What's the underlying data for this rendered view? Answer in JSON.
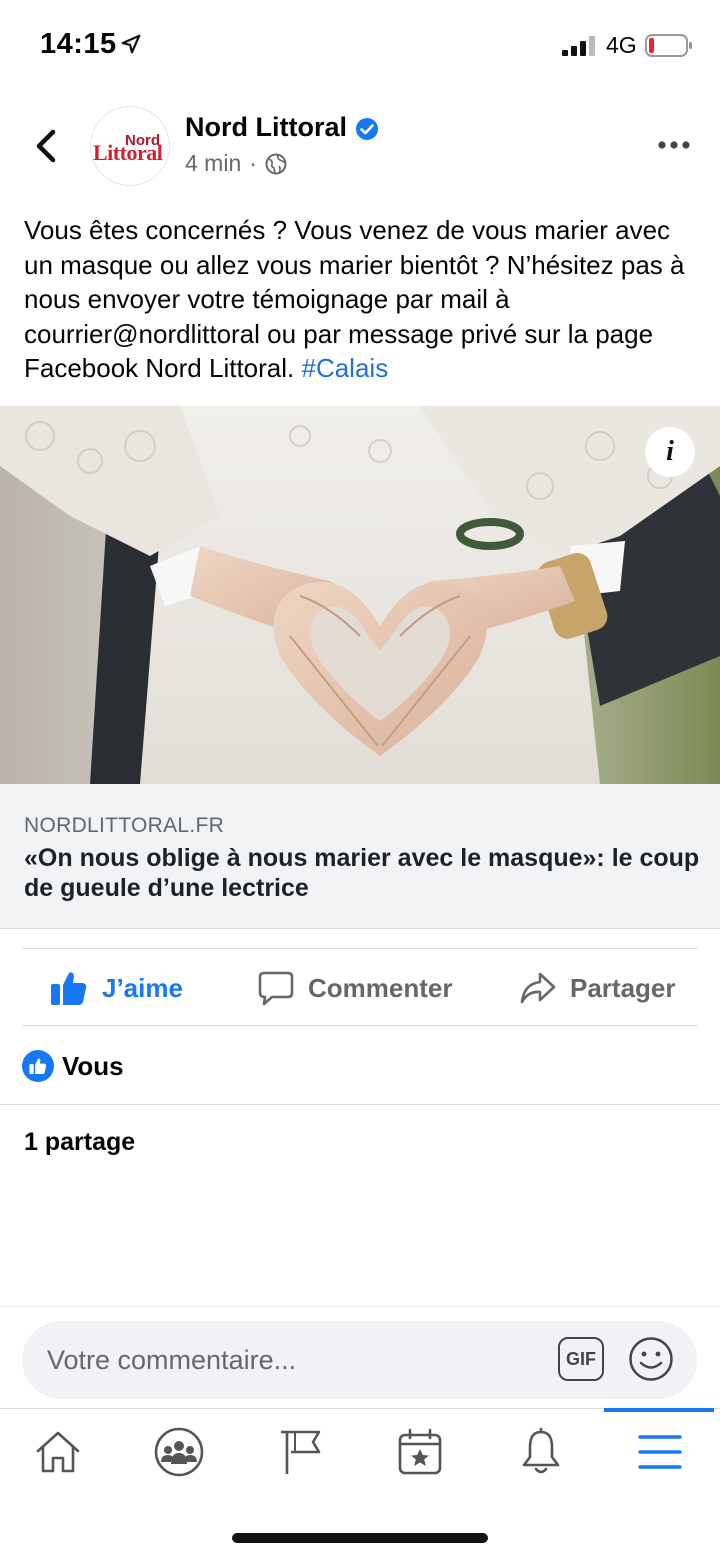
{
  "status_bar": {
    "time": "14:15",
    "network": "4G"
  },
  "post": {
    "page_name": "Nord Littoral",
    "avatar_logo": {
      "line1": "Nord",
      "line2": "Littoral"
    },
    "time_ago": "4 min",
    "separator": "·",
    "text": "Vous êtes concernés ? Vous venez de vous marier avec un masque ou allez vous marier bientôt ? N’hésitez pas à nous envoyer votre témoignage par mail à courrier@nordlittoral ou par message privé sur la page Facebook Nord Littoral.",
    "hashtag": "#Calais",
    "image_info_label": "i",
    "link": {
      "domain": "NORDLITTORAL.FR",
      "title": "«On nous oblige à nous marier avec le masque»: le coup de gueule d’une lectrice"
    }
  },
  "actions": {
    "like": "J’aime",
    "comment": "Commenter",
    "share": "Partager"
  },
  "reactions": {
    "label": "Vous"
  },
  "shares_count": "1 partage",
  "comment_box": {
    "placeholder": "Votre commentaire...",
    "gif_label": "GIF"
  },
  "colors": {
    "accent": "#1877f2",
    "hashtag": "#216fdb",
    "brand_red": "#d21f37"
  },
  "tab_bar": {
    "tabs": [
      {
        "icon": "home-icon"
      },
      {
        "icon": "groups-icon"
      },
      {
        "icon": "pages-flag-icon"
      },
      {
        "icon": "events-icon"
      },
      {
        "icon": "notifications-bell-icon"
      },
      {
        "icon": "menu-icon",
        "active": true
      }
    ]
  }
}
